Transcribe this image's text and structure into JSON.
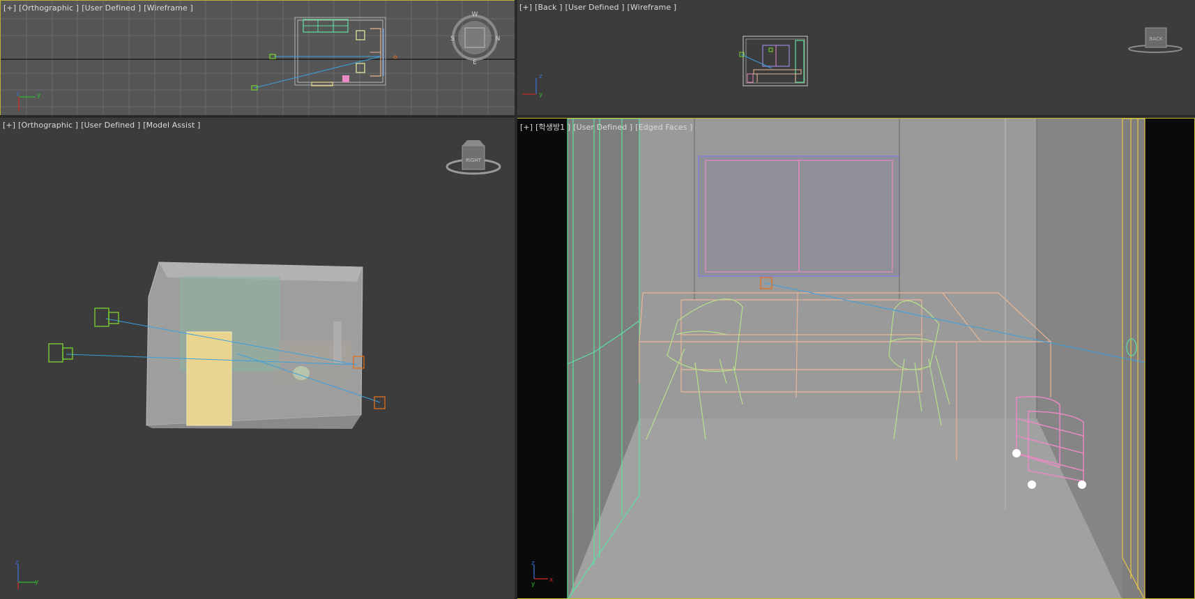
{
  "viewports": {
    "top_left": {
      "labels": [
        "[+]",
        "[Orthographic ]",
        "[User Defined ]",
        "[Wireframe ]"
      ],
      "compass": {
        "n": "N",
        "s": "S",
        "e": "E",
        "w": "W"
      }
    },
    "top_right": {
      "labels": [
        "[+]",
        "[Back ]",
        "[User Defined ]",
        "[Wireframe ]"
      ],
      "viewcube_face": "BACK"
    },
    "bottom_left": {
      "labels": [
        "[+]",
        "[Orthographic ]",
        "[User Defined ]",
        "[Model Assist ]"
      ],
      "viewcube_face": "RIGHT"
    },
    "bottom_right": {
      "labels": [
        "[+]",
        "[학생방1 ]",
        "[User Defined ]",
        "[Edged Faces ]"
      ]
    }
  },
  "axes": {
    "x": "x",
    "y": "y",
    "z": "z"
  },
  "colors": {
    "viewport_gray": "#565656",
    "viewport_dark": "#3c3c3c",
    "active_border": "#c7c02c",
    "camera_green": "#7cd62f",
    "target_orange": "#e0701e",
    "link_blue": "#3aa0e0",
    "furniture_peach": "#e8b696",
    "chair_green": "#b7e08a",
    "cart_pink": "#e88ac4",
    "wardrobe_green": "#5fe0a0"
  }
}
